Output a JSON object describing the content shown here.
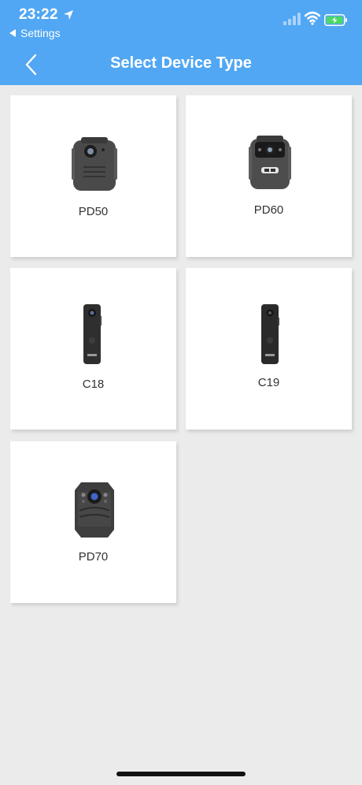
{
  "status_bar": {
    "time": "23:22",
    "back_app_label": "Settings"
  },
  "nav": {
    "title": "Select Device Type"
  },
  "devices": [
    {
      "label": "PD50"
    },
    {
      "label": "PD60"
    },
    {
      "label": "C18"
    },
    {
      "label": "C19"
    },
    {
      "label": "PD70"
    }
  ],
  "colors": {
    "header": "#51a7f3",
    "background": "#ebebeb",
    "card": "#ffffff",
    "battery_fill": "#4cd964"
  }
}
